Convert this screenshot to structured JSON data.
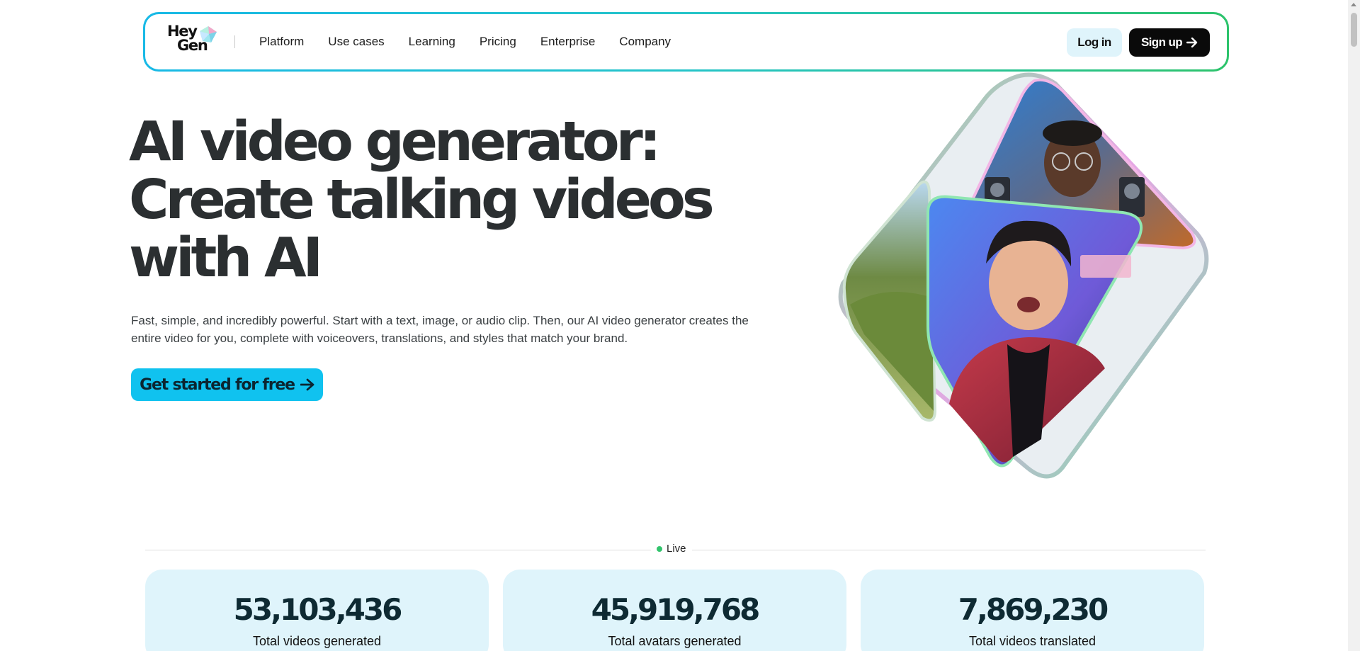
{
  "nav": {
    "logo": {
      "line1": "Hey",
      "line2": "Gen"
    },
    "links": [
      "Platform",
      "Use cases",
      "Learning",
      "Pricing",
      "Enterprise",
      "Company"
    ],
    "login": "Log in",
    "signup": "Sign up"
  },
  "hero": {
    "title_lines": [
      "AI video generator:",
      "Create talking videos",
      "with AI"
    ],
    "subtitle_line1": "Fast, simple, and incredibly powerful. Start with a text, image, or audio clip. Then, our AI video generator creates the",
    "subtitle_line2": "entire video for you, complete with voiceovers, translations, and styles that match your brand.",
    "cta": "Get started for free"
  },
  "live": {
    "label": "Live"
  },
  "stats": [
    {
      "value": "53,103,436",
      "label": "Total videos generated"
    },
    {
      "value": "45,919,768",
      "label": "Total avatars generated"
    },
    {
      "value": "7,869,230",
      "label": "Total videos translated"
    }
  ],
  "colors": {
    "accent_cyan": "#10c2ef",
    "nav_gradient_start": "#18b9e6",
    "nav_gradient_end": "#2cc36b",
    "stat_bg": "#dff4fb",
    "live_dot": "#33c46d"
  },
  "icons": [
    "heygen-gem-icon",
    "arrow-right-icon"
  ]
}
